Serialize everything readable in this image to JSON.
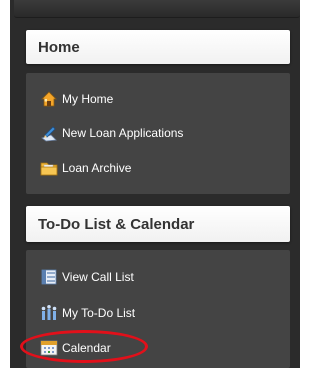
{
  "sections": [
    {
      "title": "Home",
      "items": [
        {
          "label": "My Home",
          "icon": "house-icon"
        },
        {
          "label": "New Loan Applications",
          "icon": "pen-paper-icon"
        },
        {
          "label": "Loan Archive",
          "icon": "folder-icon"
        }
      ]
    },
    {
      "title": "To-Do List & Calendar",
      "items": [
        {
          "label": "View Call List",
          "icon": "list-icon"
        },
        {
          "label": "My To-Do List",
          "icon": "people-list-icon"
        },
        {
          "label": "Calendar",
          "icon": "calendar-icon"
        }
      ]
    }
  ],
  "colors": {
    "panel_bg": "#444444",
    "frame_bg": "#2b2b2b",
    "highlight_ring": "#e2101a"
  }
}
